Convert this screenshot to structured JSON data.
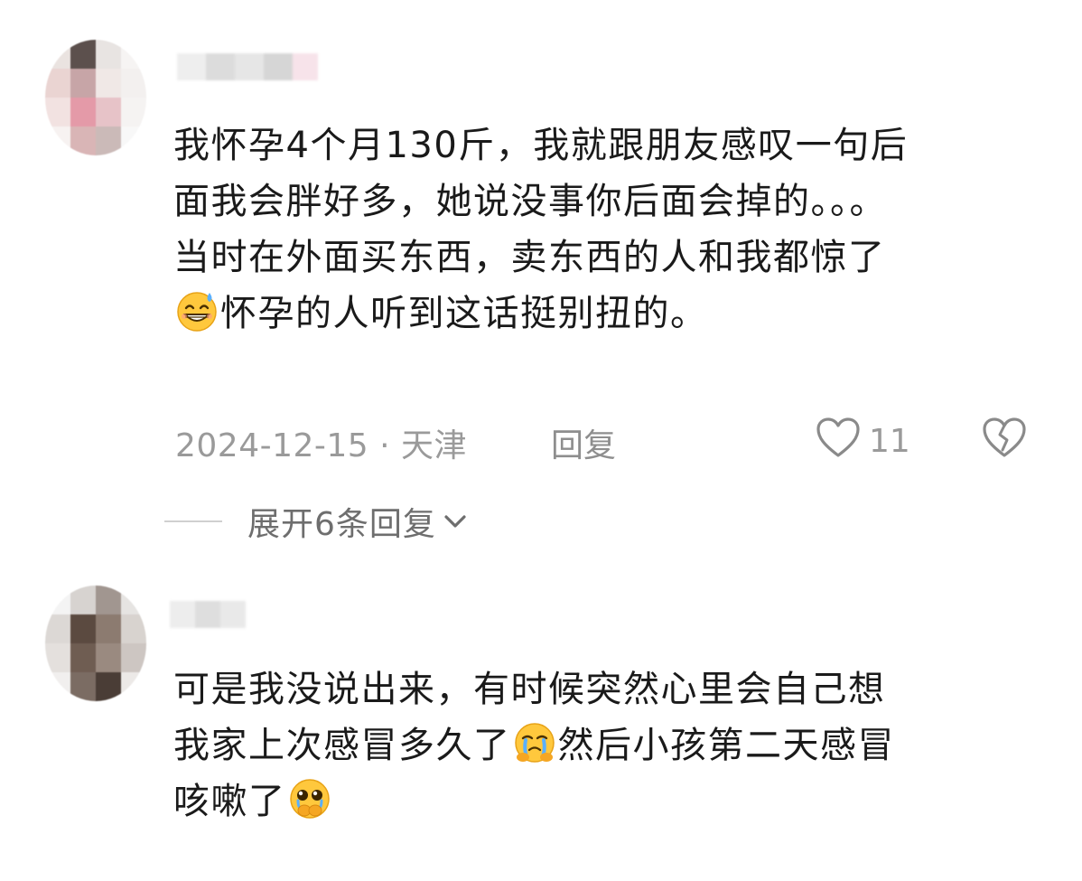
{
  "comments": [
    {
      "text_lines": [
        "我怀孕4个月130斤，我就跟朋友感叹一句后",
        "面我会胖好多，她说没事你后面会掉的。。。",
        "当时在外面买东西，卖东西的人和我都惊了"
      ],
      "text_line4_after_emoji": "怀孕的人听到这话挺别扭的。",
      "emoji_line4": "grinning-sweat-emoji",
      "date_location": "2024-12-15 · 天津",
      "reply_label": "回复",
      "like_count": "11",
      "expand_label": "展开6条回复"
    },
    {
      "text_line1": "可是我没说出来，有时候突然心里会自己想",
      "text_line2_before_emoji": "我家上次感冒多久了",
      "emoji_line2": "crying-hug-emoji",
      "text_line2_after_emoji": "然后小孩第二天感冒",
      "text_line3_before_emoji": "咳嗽了",
      "emoji_line3": "pleading-hands-emoji"
    }
  ],
  "colors": {
    "text": "#1a1a1a",
    "meta": "#9a9a9a",
    "expand": "#6e6e6e",
    "emoji_face": "#FFC83D"
  }
}
